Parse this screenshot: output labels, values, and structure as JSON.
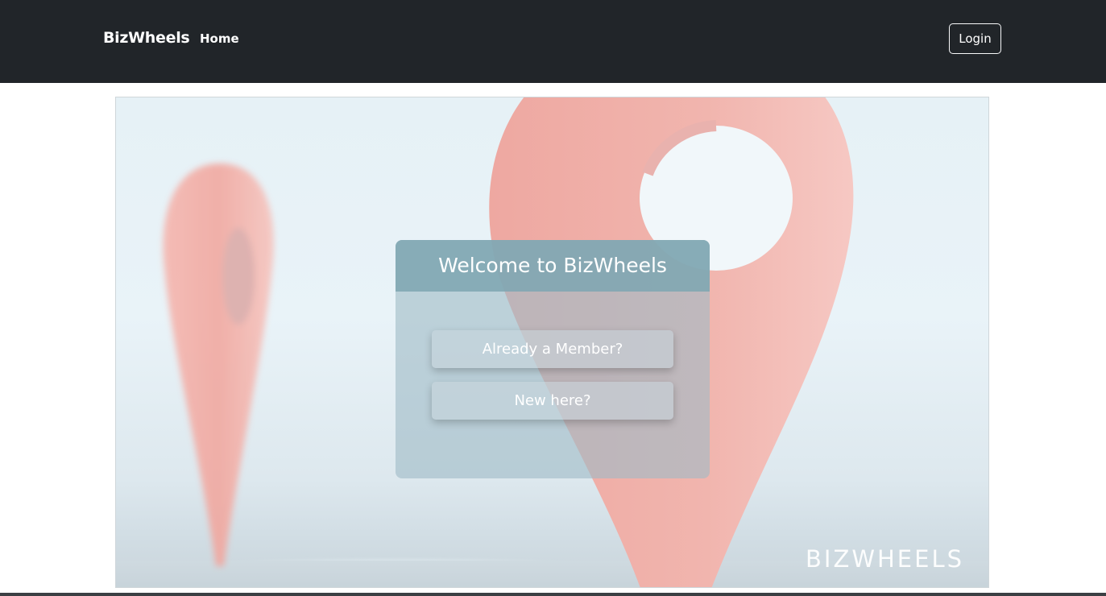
{
  "navbar": {
    "brand": "BizWheels",
    "links": [
      {
        "label": "Home"
      }
    ],
    "login_label": "Login"
  },
  "hero": {
    "watermark": "BIZWHEELS",
    "card": {
      "title": "Welcome to BizWheels",
      "member_button": "Already a Member?",
      "new_button": "New here?"
    }
  },
  "colors": {
    "navbar_bg": "#212529",
    "pin": "#f0a8a2",
    "card_header": "#8aacb8"
  }
}
